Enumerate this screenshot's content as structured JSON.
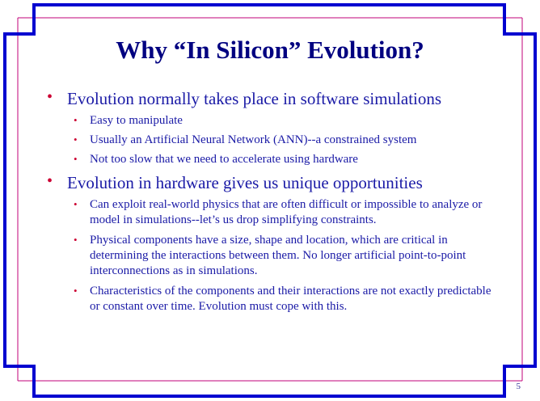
{
  "slide": {
    "title": "Why “In Silicon” Evolution?",
    "page_number": "5",
    "bullet_glyph": "•",
    "colors": {
      "frame": "#0000d0",
      "guide_line": "#c0007a",
      "title": "#000080",
      "text": "#1a1aa6",
      "bullet": "#cc0033"
    },
    "points": [
      {
        "text": "Evolution normally takes place in software simulations",
        "subpoints": [
          "Easy to manipulate",
          "Usually an Artificial Neural Network (ANN)--a constrained system",
          "Not too slow that we need to accelerate using hardware"
        ]
      },
      {
        "text": "Evolution in hardware gives us unique opportunities",
        "subpoints": [
          "Can exploit real-world physics that are often difficult or impossible to analyze or model in simulations--let’s us drop simplifying constraints.",
          "Physical components have a size, shape and location, which are critical in determining the interactions between them.  No longer artificial point-to-point interconnections as in simulations.",
          "Characteristics of the components and their interactions are not exactly predictable or constant over time.  Evolution must cope with this."
        ]
      }
    ]
  }
}
